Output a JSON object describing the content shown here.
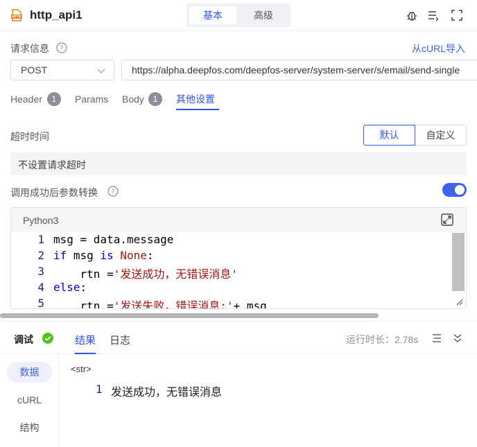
{
  "header": {
    "title": "http_api1",
    "modes": [
      "基本",
      "高级"
    ],
    "active_mode": "基本",
    "icons": [
      "http-icon",
      "bug-icon",
      "list-icon",
      "fullscreen-icon"
    ]
  },
  "request": {
    "label": "请求信息",
    "import_link": "从cURL导入",
    "method": "POST",
    "url": "https://alpha.deepfos.com/deepfos-server/system-server/s/email/send-single"
  },
  "tabs": [
    {
      "label": "Header",
      "badge": "1"
    },
    {
      "label": "Params"
    },
    {
      "label": "Body",
      "badge": "1"
    },
    {
      "label": "其他设置",
      "active": true
    }
  ],
  "timeout": {
    "label": "超时时间",
    "options": [
      "默认",
      "自定义"
    ],
    "selected": "默认",
    "description": "不设置请求超时"
  },
  "transform": {
    "label": "调用成功后参数转换",
    "enabled": true
  },
  "editor": {
    "language": "Python3",
    "lines": [
      {
        "n": "1",
        "indent": "",
        "parts": [
          [
            "",
            "msg = data.message"
          ]
        ]
      },
      {
        "n": "2",
        "indent": "",
        "parts": [
          [
            "kw",
            "if"
          ],
          [
            "",
            " msg "
          ],
          [
            "kw",
            "is"
          ],
          [
            "",
            " "
          ],
          [
            "kw2",
            "None"
          ],
          [
            "",
            ":"
          ]
        ]
      },
      {
        "n": "3",
        "indent": "    ",
        "parts": [
          [
            "",
            "rtn ="
          ],
          [
            "str",
            "'发送成功，无错误消息'"
          ]
        ]
      },
      {
        "n": "4",
        "indent": "",
        "parts": [
          [
            "kw",
            "else"
          ],
          [
            "",
            ":"
          ]
        ]
      },
      {
        "n": "5",
        "indent": "    ",
        "parts": [
          [
            "",
            "rtn ="
          ],
          [
            "str",
            "'发送失败，错误消息:'"
          ],
          [
            "",
            "+ msg"
          ]
        ]
      }
    ]
  },
  "debug": {
    "title": "调试",
    "status": "success",
    "tabs": [
      "结果",
      "日志"
    ],
    "active_tab": "结果",
    "runtime": "运行时长：2.78s",
    "side_items": [
      "数据",
      "cURL",
      "结构"
    ],
    "active_side": "数据",
    "type_tag": "<str>",
    "result_line_number": "1",
    "result": "发送成功，无错误消息"
  },
  "colors": {
    "accent": "#2f54eb",
    "success": "#52c41a",
    "toggle_on": "#3f63ea"
  }
}
